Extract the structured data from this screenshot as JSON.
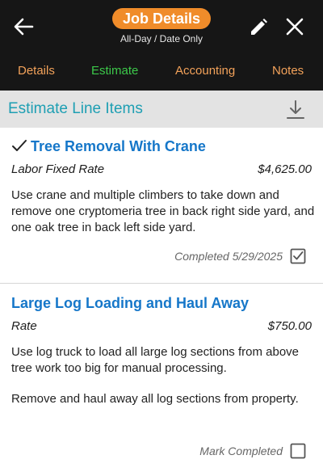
{
  "header": {
    "title": "Job Details",
    "subtitle": "All-Day / Date Only",
    "back_icon": "arrow-left-icon",
    "edit_icon": "pencil-icon",
    "close_icon": "close-icon",
    "accent_color": "#f08c2a"
  },
  "tabs": [
    {
      "label": "Details",
      "active": false
    },
    {
      "label": "Estimate",
      "active": true
    },
    {
      "label": "Accounting",
      "active": false
    },
    {
      "label": "Notes",
      "active": false
    }
  ],
  "section": {
    "title": "Estimate Line Items",
    "download_icon": "download-icon"
  },
  "line_items": [
    {
      "title": "Tree Removal With Crane",
      "completed": true,
      "rate_type": "Labor Fixed Rate",
      "amount": "$4,625.00",
      "description": "Use crane and multiple climbers to take down and remove one cryptomeria tree in back right side yard, and one oak tree in back left side yard.",
      "status_text": "Completed 5/29/2025"
    },
    {
      "title": "Large Log Loading and Haul Away",
      "completed": false,
      "rate_type": "Rate",
      "amount": "$750.00",
      "description": "Use log truck to load all large log sections from above tree work too big for manual processing.",
      "description_2": "Remove and haul away all log sections from property.",
      "status_text": "Mark Completed"
    }
  ]
}
